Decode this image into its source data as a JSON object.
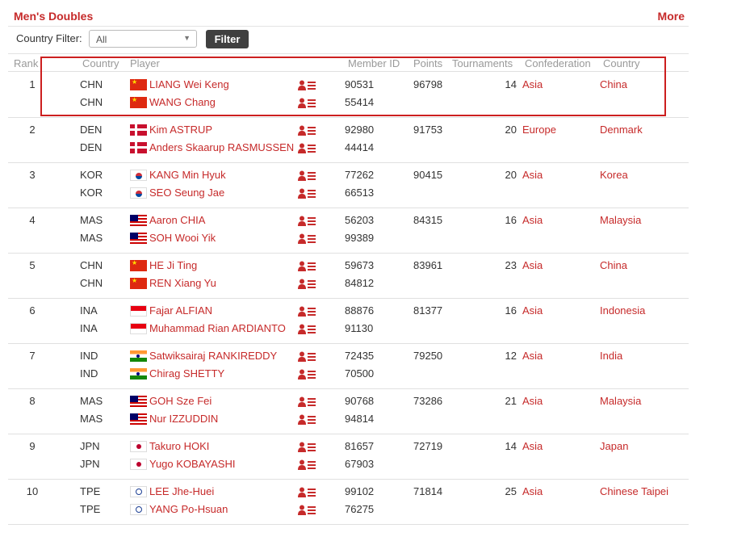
{
  "header": {
    "title": "Men's Doubles",
    "more_label": "More"
  },
  "filter": {
    "label": "Country Filter:",
    "selected": "All",
    "button_label": "Filter"
  },
  "columns": {
    "rank": "Rank",
    "country": "Country",
    "player": "Player",
    "member_id": "Member ID",
    "points": "Points",
    "tournaments": "Tournaments",
    "confederation": "Confederation",
    "country_name": "Country"
  },
  "rows": [
    {
      "rank": "1",
      "points": "96798",
      "tournaments": "14",
      "confederation": "Asia",
      "country_name": "China",
      "players": [
        {
          "code": "CHN",
          "flag": "chn",
          "name": "LIANG Wei Keng",
          "member_id": "90531"
        },
        {
          "code": "CHN",
          "flag": "chn",
          "name": "WANG Chang",
          "member_id": "55414"
        }
      ]
    },
    {
      "rank": "2",
      "points": "91753",
      "tournaments": "20",
      "confederation": "Europe",
      "country_name": "Denmark",
      "players": [
        {
          "code": "DEN",
          "flag": "den",
          "name": "Kim ASTRUP",
          "member_id": "92980"
        },
        {
          "code": "DEN",
          "flag": "den",
          "name": "Anders Skaarup RASMUSSEN",
          "member_id": "44414"
        }
      ]
    },
    {
      "rank": "3",
      "points": "90415",
      "tournaments": "20",
      "confederation": "Asia",
      "country_name": "Korea",
      "players": [
        {
          "code": "KOR",
          "flag": "kor",
          "name": "KANG Min Hyuk",
          "member_id": "77262"
        },
        {
          "code": "KOR",
          "flag": "kor",
          "name": "SEO Seung Jae",
          "member_id": "66513"
        }
      ]
    },
    {
      "rank": "4",
      "points": "84315",
      "tournaments": "16",
      "confederation": "Asia",
      "country_name": "Malaysia",
      "players": [
        {
          "code": "MAS",
          "flag": "mas",
          "name": "Aaron CHIA",
          "member_id": "56203"
        },
        {
          "code": "MAS",
          "flag": "mas",
          "name": "SOH Wooi Yik",
          "member_id": "99389"
        }
      ]
    },
    {
      "rank": "5",
      "points": "83961",
      "tournaments": "23",
      "confederation": "Asia",
      "country_name": "China",
      "players": [
        {
          "code": "CHN",
          "flag": "chn",
          "name": "HE Ji Ting",
          "member_id": "59673"
        },
        {
          "code": "CHN",
          "flag": "chn",
          "name": "REN Xiang Yu",
          "member_id": "84812"
        }
      ]
    },
    {
      "rank": "6",
      "points": "81377",
      "tournaments": "16",
      "confederation": "Asia",
      "country_name": "Indonesia",
      "players": [
        {
          "code": "INA",
          "flag": "ina",
          "name": "Fajar ALFIAN",
          "member_id": "88876"
        },
        {
          "code": "INA",
          "flag": "ina",
          "name": "Muhammad Rian ARDIANTO",
          "member_id": "91130"
        }
      ]
    },
    {
      "rank": "7",
      "points": "79250",
      "tournaments": "12",
      "confederation": "Asia",
      "country_name": "India",
      "players": [
        {
          "code": "IND",
          "flag": "ind",
          "name": "Satwiksairaj RANKIREDDY",
          "member_id": "72435"
        },
        {
          "code": "IND",
          "flag": "ind",
          "name": "Chirag SHETTY",
          "member_id": "70500"
        }
      ]
    },
    {
      "rank": "8",
      "points": "73286",
      "tournaments": "21",
      "confederation": "Asia",
      "country_name": "Malaysia",
      "players": [
        {
          "code": "MAS",
          "flag": "mas",
          "name": "GOH Sze Fei",
          "member_id": "90768"
        },
        {
          "code": "MAS",
          "flag": "mas",
          "name": "Nur IZZUDDIN",
          "member_id": "94814"
        }
      ]
    },
    {
      "rank": "9",
      "points": "72719",
      "tournaments": "14",
      "confederation": "Asia",
      "country_name": "Japan",
      "players": [
        {
          "code": "JPN",
          "flag": "jpn",
          "name": "Takuro HOKI",
          "member_id": "81657"
        },
        {
          "code": "JPN",
          "flag": "jpn",
          "name": "Yugo KOBAYASHI",
          "member_id": "67903"
        }
      ]
    },
    {
      "rank": "10",
      "points": "71814",
      "tournaments": "25",
      "confederation": "Asia",
      "country_name": "Chinese Taipei",
      "players": [
        {
          "code": "TPE",
          "flag": "tpe",
          "name": "LEE Jhe-Huei",
          "member_id": "99102"
        },
        {
          "code": "TPE",
          "flag": "tpe",
          "name": "YANG Po-Hsuan",
          "member_id": "76275"
        }
      ]
    }
  ]
}
